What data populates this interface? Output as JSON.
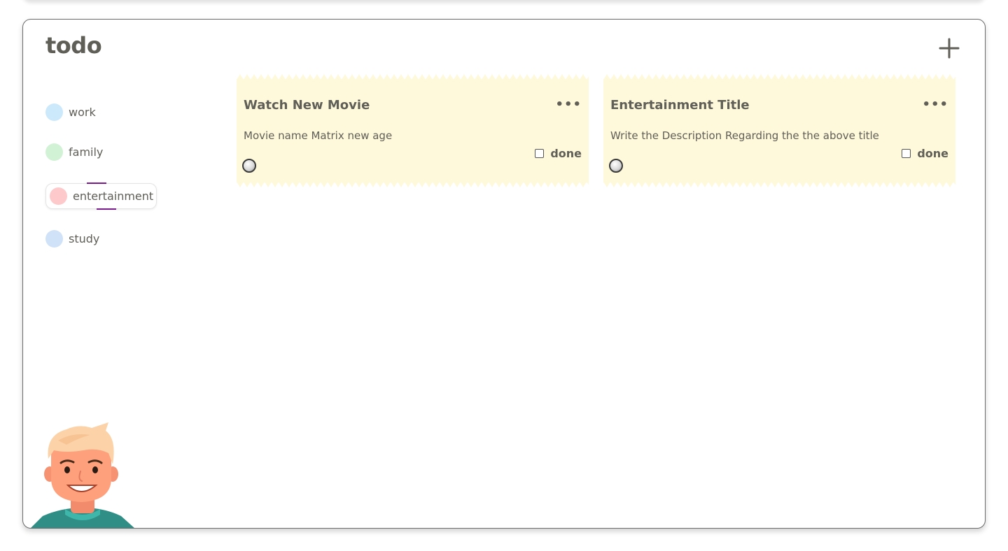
{
  "app": {
    "title": "todo"
  },
  "categories": [
    {
      "label": "work",
      "color": "#cbe9fb"
    },
    {
      "label": "family",
      "color": "#d2f2d6"
    },
    {
      "label": "entertainment",
      "color": "#fec9cb",
      "active": true
    },
    {
      "label": "study",
      "color": "#cfe2f8"
    }
  ],
  "notes": [
    {
      "title": "Watch New Movie",
      "description": "Movie name Matrix new age",
      "menu": "•••",
      "done_label": "done",
      "done": false
    },
    {
      "title": "Entertainment Title",
      "description": "Write the Description Regarding the the above title",
      "menu": "•••",
      "done_label": "done",
      "done": false
    }
  ],
  "colors": {
    "note_background": "#fff9db",
    "text": "#5f5e57",
    "active_marker": "#7a1a8c"
  }
}
